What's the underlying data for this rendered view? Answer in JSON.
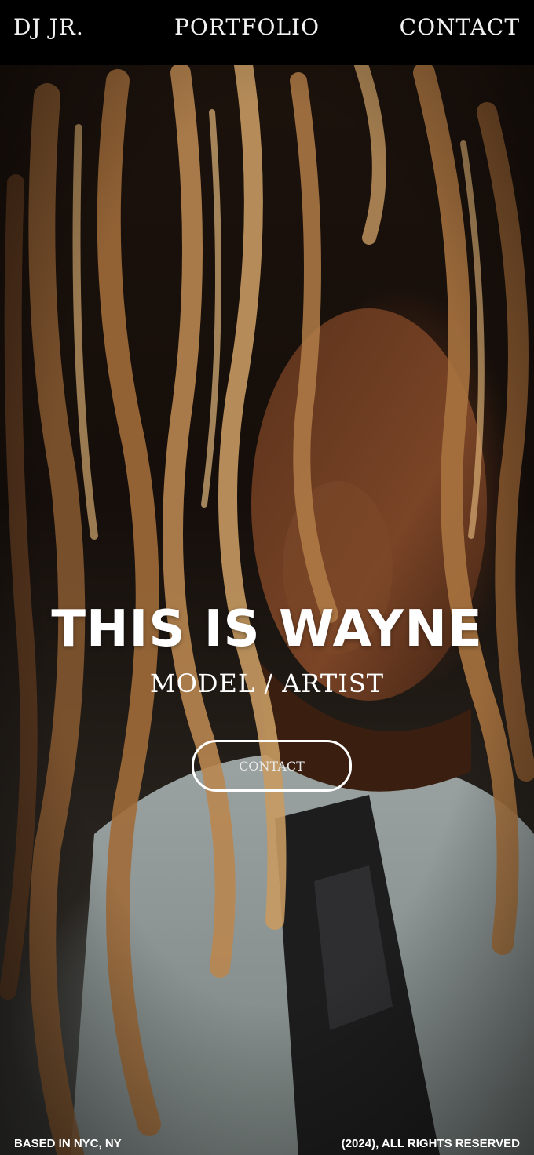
{
  "nav": {
    "logo": "DJ JR.",
    "portfolio": "PORTFOLIO",
    "contact": "CONTACT"
  },
  "hero": {
    "image": "portrait photo",
    "title": "THIS IS WAYNE",
    "subtitle": "MODEL / ARTIST",
    "cta_label": "CONTACT"
  },
  "footer": {
    "location": "BASED IN NYC, NY",
    "copyright": "(2024), ALL RIGHTS RESERVED"
  },
  "colors": {
    "nav_background": "#000000",
    "text": "#ffffff"
  }
}
